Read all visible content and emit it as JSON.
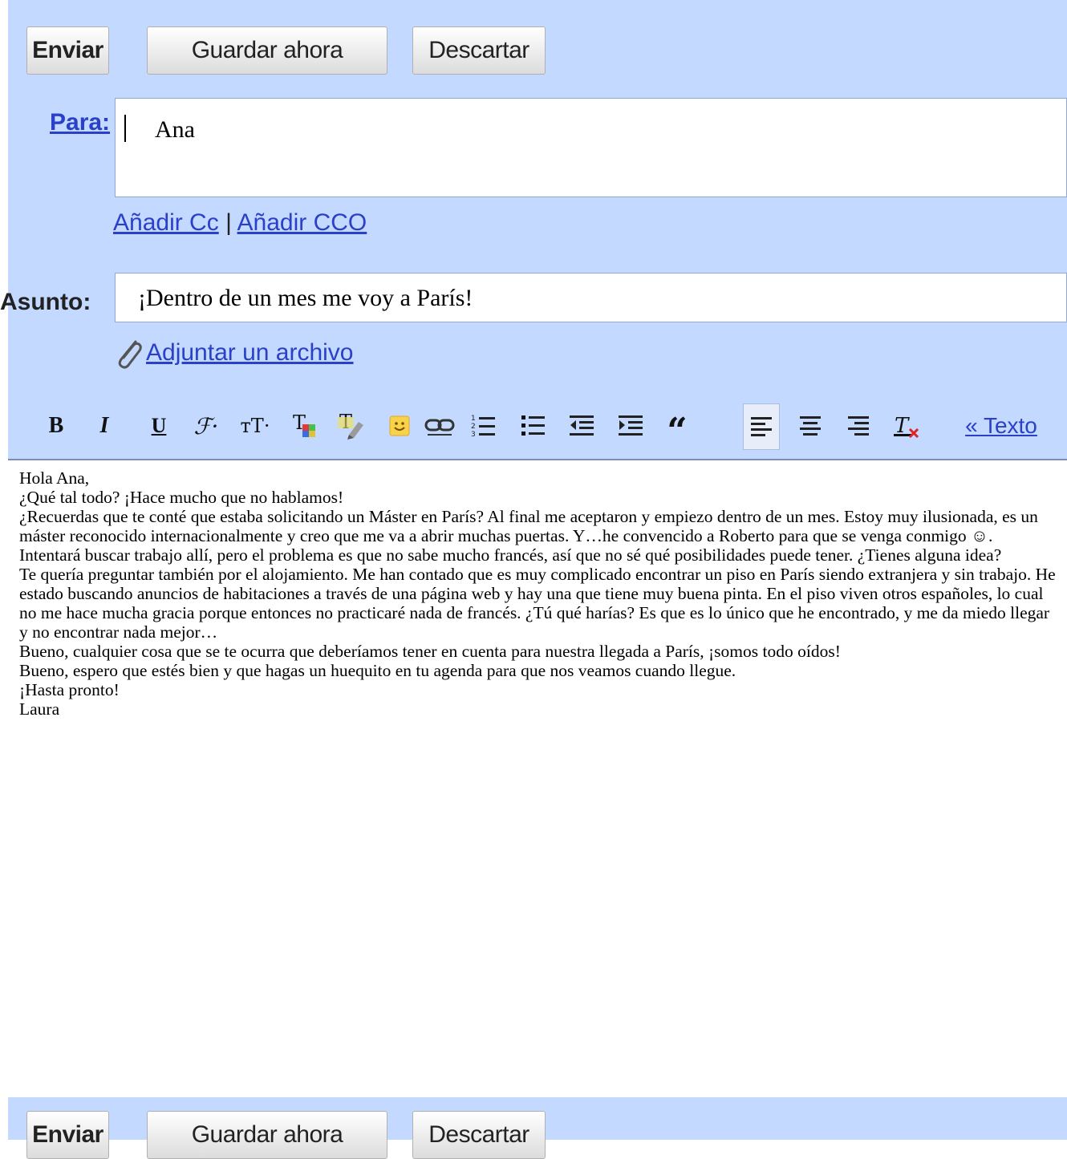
{
  "top_buttons": {
    "send": "Enviar",
    "save": "Guardar ahora",
    "discard": "Descartar"
  },
  "bottom_buttons": {
    "send": "Enviar",
    "save": "Guardar ahora",
    "discard": "Descartar"
  },
  "to": {
    "label": "Para:",
    "value": "Ana"
  },
  "cc_links": {
    "cc": "Añadir Cc",
    "separator": "|",
    "bcc": "Añadir CCO"
  },
  "subject": {
    "label": "Asunto:",
    "value": "¡Dentro de un mes me voy a París!"
  },
  "attach": {
    "label": "Adjuntar un archivo",
    "icon": "paperclip-icon"
  },
  "toolbar": {
    "bold": "B",
    "italic": "I",
    "underline": "U",
    "font": "ℱ·",
    "size": "тТ·",
    "plain_text_link": "« Texto",
    "icons": [
      "bold-icon",
      "italic-icon",
      "underline-icon",
      "font-icon",
      "font-size-icon",
      "text-color-icon",
      "highlight-color-icon",
      "emoticon-icon",
      "link-icon",
      "numbered-list-icon",
      "bulleted-list-icon",
      "indent-less-icon",
      "indent-more-icon",
      "quote-icon",
      "align-left-icon",
      "align-center-icon",
      "align-right-icon",
      "remove-formatting-icon"
    ]
  },
  "message": {
    "lines": [
      "Hola Ana,",
      "¿Qué tal todo? ¡Hace mucho que no hablamos!",
      "¿Recuerdas que te conté que estaba solicitando un Máster en París? Al final me aceptaron y empiezo dentro de un mes. Estoy muy ilusionada, es un máster reconocido internacionalmente y creo que me va a abrir muchas puertas. Y…he convencido a Roberto para que se venga conmigo ☺.  Intentará buscar trabajo allí, pero el problema es que no sabe mucho francés, así que no sé qué posibilidades puede tener. ¿Tienes alguna idea?",
      "Te quería preguntar también por el alojamiento. Me han contado que es muy complicado encontrar un piso en París siendo extranjera y sin trabajo. He estado buscando anuncios de habitaciones a través de una página web y hay una que tiene muy buena pinta. En el piso viven otros españoles, lo cual no me hace mucha gracia porque entonces no practicaré nada de francés. ¿Tú qué harías? Es que es lo único que he encontrado, y me da miedo llegar y no encontrar nada mejor…",
      "Bueno, cualquier cosa que se te ocurra que deberíamos tener en cuenta para nuestra llegada a París, ¡somos todo oídos!",
      "Bueno, espero que estés bien y que hagas un huequito en tu agenda para que nos veamos cuando llegue.",
      "¡Hasta pronto!",
      "Laura"
    ]
  },
  "colors": {
    "background": "#c3d9ff",
    "link": "#2a40c8",
    "emoticon": "#f7d34a"
  }
}
